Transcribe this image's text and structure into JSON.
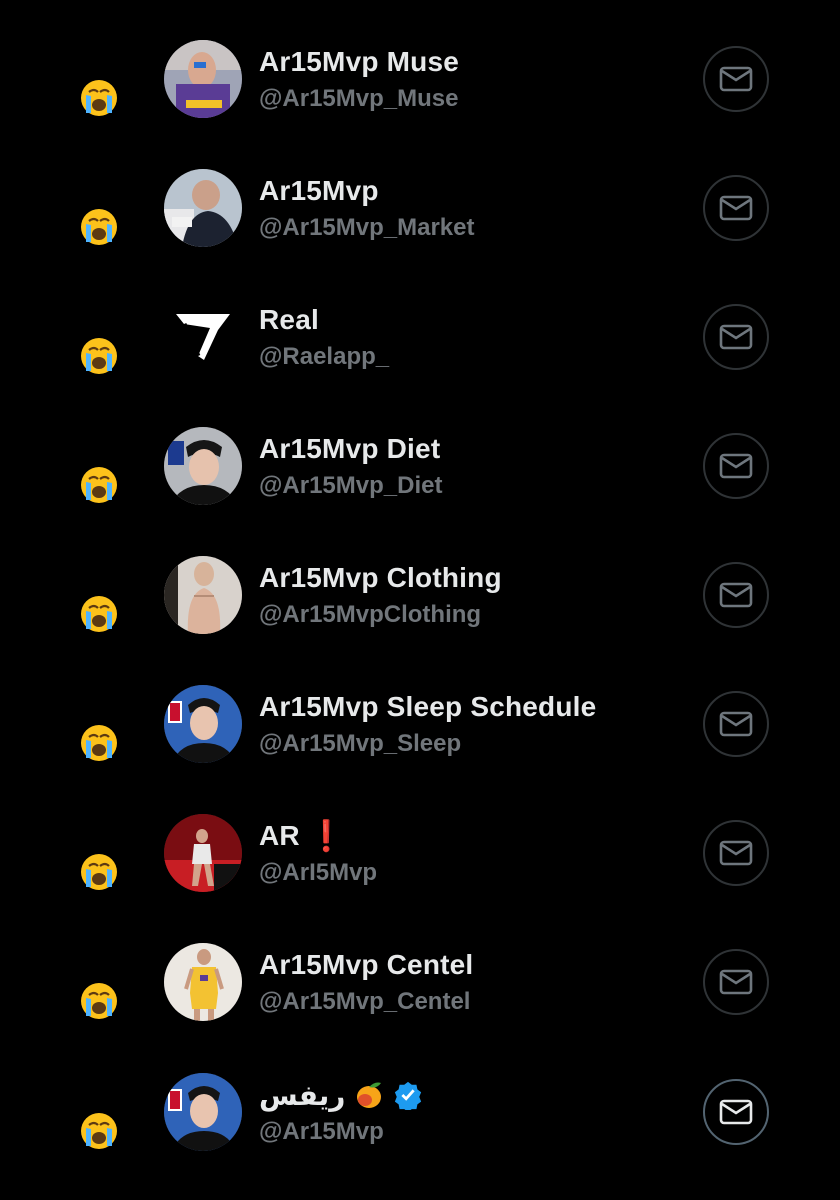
{
  "accounts": [
    {
      "name": "Ar15Mvp Muse",
      "handle": "@Ar15Mvp_Muse",
      "avatar": "player-purple-jersey-photo",
      "reaction": "loudly-crying-face"
    },
    {
      "name": "Ar15Mvp",
      "handle": "@Ar15Mvp_Market",
      "avatar": "man-in-suit-photo",
      "reaction": "loudly-crying-face"
    },
    {
      "name": "Real",
      "handle": "@Raelapp_",
      "avatar": "real-logo",
      "reaction": "loudly-crying-face"
    },
    {
      "name": "Ar15Mvp Diet",
      "handle": "@Ar15Mvp_Diet",
      "avatar": "player-headshot-gray-photo",
      "reaction": "loudly-crying-face"
    },
    {
      "name": "Ar15Mvp Clothing",
      "handle": "@Ar15MvpClothing",
      "avatar": "shirtless-person-photo",
      "reaction": "loudly-crying-face"
    },
    {
      "name": "Ar15Mvp Sleep Schedule",
      "handle": "@Ar15Mvp_Sleep",
      "avatar": "player-headshot-blue-photo",
      "reaction": "loudly-crying-face"
    },
    {
      "name": "AR",
      "name_suffix": "❗",
      "handle": "@ArI5Mvp",
      "avatar": "player-red-court-photo",
      "reaction": "loudly-crying-face"
    },
    {
      "name": "Ar15Mvp Centel",
      "handle": "@Ar15Mvp_Centel",
      "avatar": "player-number-15-yellow-photo",
      "reaction": "loudly-crying-face"
    },
    {
      "name": "ريفس",
      "handle": "@Ar15Mvp",
      "avatar": "player-headshot-blue-photo",
      "reaction": "loudly-crying-face",
      "badges": [
        "mango-emoji",
        "verified-badge"
      ]
    }
  ],
  "colors": {
    "background": "#000000",
    "name": "#e7e9ea",
    "handle": "#71767b",
    "button_border": "#2f3336",
    "verified": "#1d9bf0"
  }
}
